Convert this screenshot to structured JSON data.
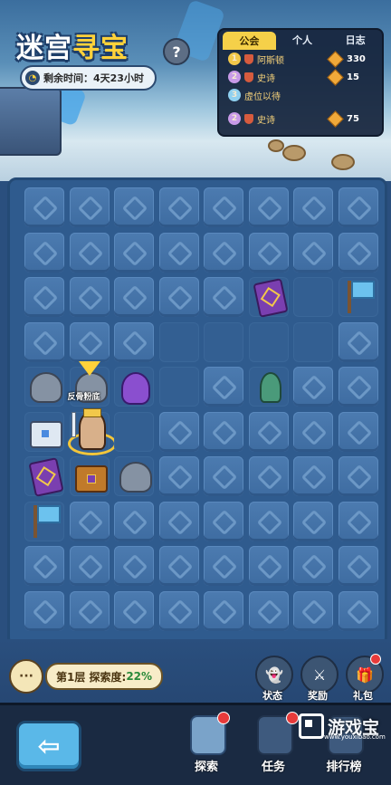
{
  "header": {
    "title_a": "迷宫",
    "title_b": "寻宝",
    "help_label": "?",
    "timer_text": "剩余时间：4天23小时"
  },
  "rank_panel": {
    "tabs": [
      {
        "label": "公会",
        "active": true
      },
      {
        "label": "个人",
        "active": false
      },
      {
        "label": "日志",
        "active": false
      }
    ],
    "rows": [
      {
        "rank": "1",
        "name": "阿斯顿",
        "score": "330",
        "rank_color": "#f2c84a"
      },
      {
        "rank": "2",
        "name": "史诗",
        "score": "15",
        "rank_color": "#c89ae8"
      },
      {
        "rank": "3",
        "name": "虚位以待",
        "score": "",
        "rank_color": "#8fd0f0"
      },
      {
        "rank": "2",
        "name": "史诗",
        "score": "75",
        "rank_color": "#c89ae8"
      }
    ]
  },
  "board": {
    "marker_label": "反骨粉底",
    "layout": [
      [
        "c",
        "c",
        "c",
        "c",
        "c",
        "c",
        "c",
        "c"
      ],
      [
        "c",
        "c",
        "c",
        "c",
        "c",
        "c",
        "c",
        "c"
      ],
      [
        "c",
        "c",
        "c",
        "c",
        "c",
        "book",
        "o",
        "flag"
      ],
      [
        "c",
        "c",
        "c",
        "o",
        "o",
        "o",
        "o",
        "c"
      ],
      [
        "statue",
        "statue-marker",
        "ghost",
        "o",
        "c",
        "goblin",
        "c",
        "c"
      ],
      [
        "chest-open",
        "hero",
        "o",
        "c",
        "c",
        "c",
        "c",
        "c"
      ],
      [
        "book",
        "chest",
        "statue",
        "c",
        "c",
        "c",
        "c",
        "c"
      ],
      [
        "flag",
        "c",
        "c",
        "c",
        "c",
        "c",
        "c",
        "c"
      ],
      [
        "c",
        "c",
        "c",
        "c",
        "c",
        "c",
        "c",
        "c"
      ],
      [
        "c",
        "c",
        "c",
        "c",
        "c",
        "c",
        "c",
        "c"
      ]
    ]
  },
  "status": {
    "chat_label": "···",
    "floor_text": "第1层 探索度:",
    "progress": "22%"
  },
  "side_buttons": [
    {
      "label": "状态",
      "icon": "ghost-icon"
    },
    {
      "label": "奖励",
      "icon": "sword-icon"
    },
    {
      "label": "礼包",
      "icon": "gift-icon"
    }
  ],
  "nav": {
    "back_label": "⇦",
    "items": [
      {
        "label": "探索",
        "icon": "explore-icon",
        "active": true,
        "badge": true
      },
      {
        "label": "任务",
        "icon": "task-icon",
        "active": false,
        "badge": true
      },
      {
        "label": "排行榜",
        "icon": "leaderboard-icon",
        "active": false,
        "badge": false
      }
    ]
  },
  "watermark": {
    "text": "游戏宝",
    "url": "www.youxibao.com"
  },
  "colors": {
    "accent_gold": "#ffd23a",
    "board_bg": "#2f5b8e",
    "badge_red": "#e73a3a"
  }
}
